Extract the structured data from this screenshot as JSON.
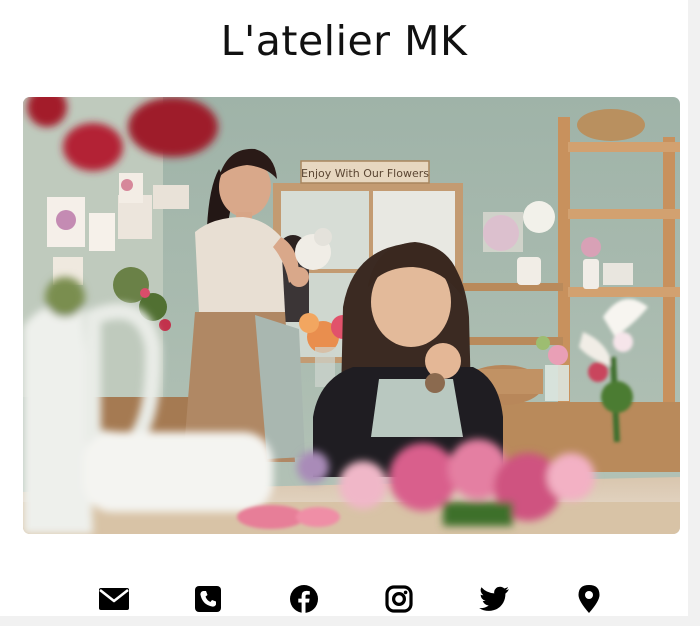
{
  "site": {
    "title": "L'atelier MK"
  },
  "hero": {
    "sign_text": "Enjoy With Our Flowers",
    "colors": {
      "wall": "#a7b9ae",
      "wood": "#c99b6a",
      "table": "#e9dccd"
    }
  },
  "social": {
    "items": [
      {
        "icon": "envelope-icon",
        "label": "Email"
      },
      {
        "icon": "phone-icon",
        "label": "Phone"
      },
      {
        "icon": "facebook-icon",
        "label": "Facebook"
      },
      {
        "icon": "instagram-icon",
        "label": "Instagram"
      },
      {
        "icon": "twitter-icon",
        "label": "Twitter"
      },
      {
        "icon": "map-pin-icon",
        "label": "Location"
      }
    ]
  }
}
